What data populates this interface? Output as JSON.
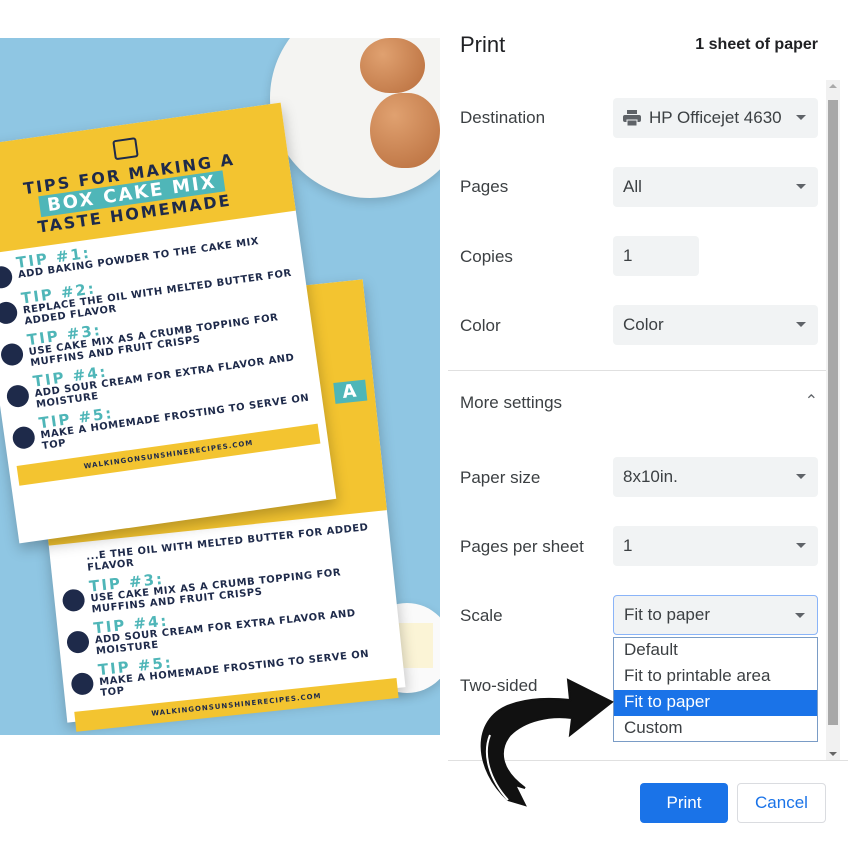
{
  "photo": {
    "card_title_1": "TIPS FOR MAKING A",
    "card_title_2": "BOX CAKE MIX",
    "card_title_3": "TASTE HOMEMADE",
    "tips": [
      {
        "num": "TIP #1:",
        "text": "ADD BAKING POWDER TO THE CAKE MIX"
      },
      {
        "num": "TIP #2:",
        "text": "REPLACE THE OIL WITH MELTED BUTTER FOR ADDED FLAVOR"
      },
      {
        "num": "TIP #3:",
        "text": "USE CAKE MIX AS A CRUMB TOPPING FOR MUFFINS AND FRUIT CRISPS"
      },
      {
        "num": "TIP #4:",
        "text": "ADD SOUR CREAM FOR EXTRA FLAVOR AND MOISTURE"
      },
      {
        "num": "TIP #5:",
        "text": "MAKE A HOMEMADE FROSTING TO SERVE ON TOP"
      }
    ],
    "back_partial": "...E THE OIL WITH MELTED BUTTER FOR ADDED FLAVOR",
    "back_head_partial": "A",
    "website": "WALKINGONSUNSHINERECIPES.COM"
  },
  "dialog": {
    "title": "Print",
    "sheet_count": "1 sheet of paper",
    "destination": {
      "label": "Destination",
      "value": "HP Officejet 4630",
      "icon": "printer-icon"
    },
    "pages": {
      "label": "Pages",
      "value": "All"
    },
    "copies": {
      "label": "Copies",
      "value": "1"
    },
    "color": {
      "label": "Color",
      "value": "Color"
    },
    "more_settings": {
      "label": "More settings",
      "expanded": true
    },
    "paper_size": {
      "label": "Paper size",
      "value": "8x10in."
    },
    "pages_per_sheet": {
      "label": "Pages per sheet",
      "value": "1"
    },
    "scale": {
      "label": "Scale",
      "value": "Fit to paper",
      "options": [
        "Default",
        "Fit to printable area",
        "Fit to paper",
        "Custom"
      ],
      "selected_index": 2
    },
    "two_sided": {
      "label": "Two-sided"
    },
    "print_button": "Print",
    "cancel_button": "Cancel",
    "accent": "#1a73e8"
  }
}
